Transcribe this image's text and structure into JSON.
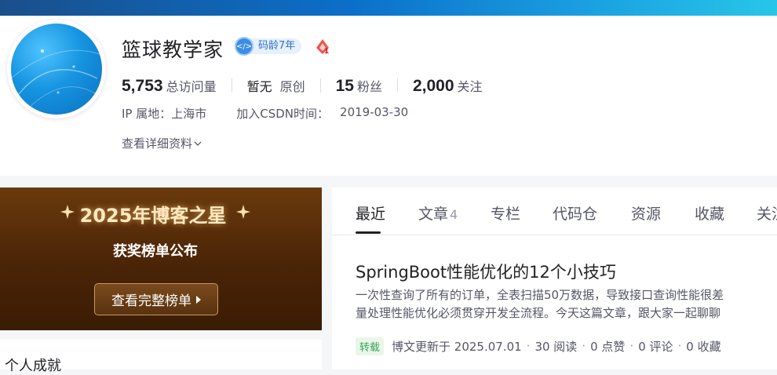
{
  "profile": {
    "name": "篮球教学家",
    "badge_text": "码龄7年",
    "stats": [
      {
        "value": "5,753",
        "label": "总访问量"
      },
      {
        "prefix": "暂无",
        "label": "原创"
      },
      {
        "value": "15",
        "label": "粉丝"
      },
      {
        "value": "2,000",
        "label": "关注"
      }
    ],
    "ip_location": "IP 属地：上海市",
    "join_label": "加入CSDN时间：",
    "join_date": "2019-03-30",
    "more_label": "查看详细资料"
  },
  "promo": {
    "title": "2025年博客之星",
    "subtitle": "获奖榜单公布",
    "button_label": "查看完整榜单"
  },
  "achievements": {
    "title": "个人成就"
  },
  "tabs": [
    {
      "label": "最近"
    },
    {
      "label": "文章",
      "count": "4"
    },
    {
      "label": "专栏"
    },
    {
      "label": "代码仓"
    },
    {
      "label": "资源"
    },
    {
      "label": "收藏"
    },
    {
      "label": "关注"
    }
  ],
  "article": {
    "title": "SpringBoot性能优化的12个小技巧",
    "desc_line1": "一次性查询了所有的订单，全表扫描50万数据，导致接口查询性能很差",
    "desc_line2": "量处理性能优化必须贯穿开发全流程。今天这篇文章，跟大家一起聊聊",
    "tag": "转载",
    "updated": "博文更新于 2025.07.01",
    "reads": "30 阅读",
    "likes": "0 点赞",
    "comments": "0 评论",
    "favorites": "0 收藏"
  },
  "colors": {
    "banner": "#0b6fc9",
    "promo_bg": "#4a2406",
    "tag_green": "#3aa35a",
    "badge_blue": "#3b8de6"
  }
}
